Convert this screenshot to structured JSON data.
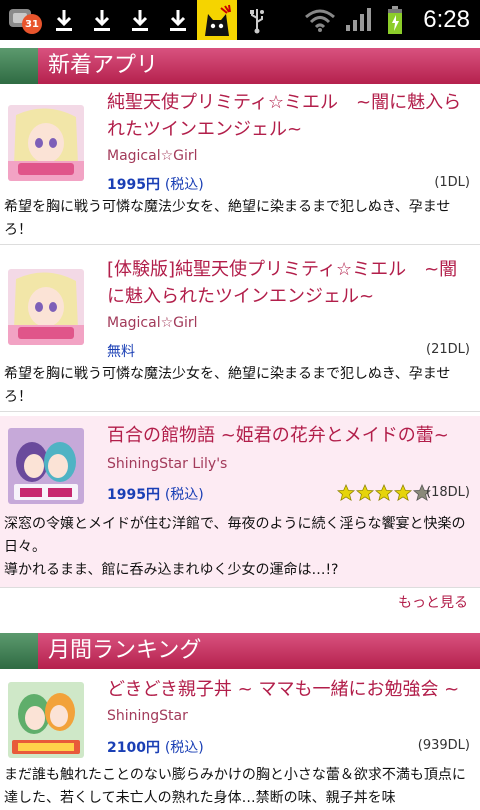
{
  "status_bar": {
    "notification_count": "31",
    "time": "6:28",
    "icons": [
      "app-notification-icon",
      "download-icon",
      "download-icon",
      "download-icon",
      "download-icon",
      "cat-app-icon",
      "usb-icon",
      "wifi-icon",
      "signal-icon",
      "battery-charging-icon"
    ]
  },
  "sections": {
    "new_apps": {
      "title": "新着アプリ",
      "items": [
        {
          "title": "純聖天使プリミティ☆ミエル　~闇に魅入られたツインエンジェル~",
          "publisher": "Magical☆Girl",
          "price": "1995円",
          "tax": "(税込)",
          "downloads": "(1DL)",
          "description": "希望を胸に戦う可憐な魔法少女を、絶望に染まるまで犯しぬき、孕ませろ！"
        },
        {
          "title": "[体験版]純聖天使プリミティ☆ミエル　~闇に魅入られたツインエンジェル~",
          "publisher": "Magical☆Girl",
          "price": "無料",
          "tax": "",
          "downloads": "(21DL)",
          "description": "希望を胸に戦う可憐な魔法少女を、絶望に染まるまで犯しぬき、孕ませろ！"
        },
        {
          "title": "百合の館物語 ~姫君の花弁とメイドの蕾~",
          "publisher": "ShiningStar Lily's",
          "price": "1995円",
          "tax": "(税込)",
          "downloads": "(18DL)",
          "rating": 4,
          "rating_max": 5,
          "description_line1": "深窓の令嬢とメイドが住む洋館で、毎夜のように続く淫らな饗宴と快楽の日々。",
          "description_line2": "導かれるまま、館に呑み込まれゆく少女の運命は…!?"
        }
      ],
      "more_label": "もっと見る"
    },
    "monthly_ranking": {
      "title": "月間ランキング",
      "items": [
        {
          "title": "どきどき親子丼 ~ ママも一緒にお勉強会 ~",
          "publisher": "ShiningStar",
          "price": "2100円",
          "tax": "(税込)",
          "downloads": "(939DL)",
          "description": "まだ誰も触れたことのない膨らみかけの胸と小さな蕾＆欲求不満も頂点に達した、若くして未亡人の熟れた身体…禁断の味、親子丼を味"
        }
      ]
    }
  },
  "colors": {
    "header_pink": "#c42a58",
    "header_green": "#3e7d53",
    "title_text": "#b21e4a",
    "price_text": "#1a3fb5",
    "highlight_bg": "#fdebf3"
  }
}
